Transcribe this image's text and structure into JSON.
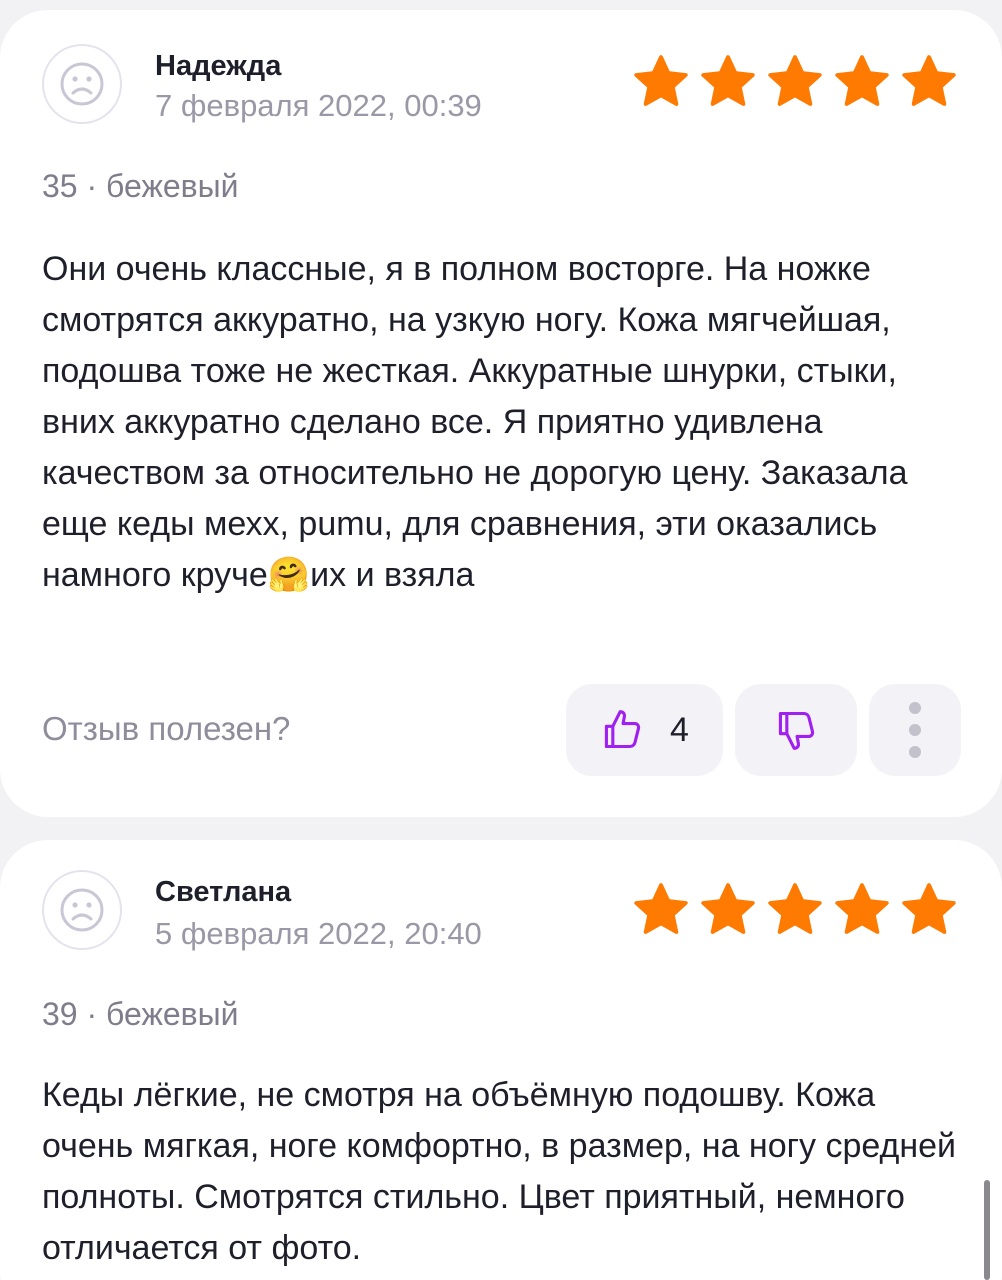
{
  "reviews": [
    {
      "author": "Надежда",
      "date": "7 февраля 2022, 00:39",
      "rating": 5,
      "variant": "35 · бежевый",
      "text_before_emoji": "Они очень классные, я в полном восторге. На ножке смотрятся аккуратно, на узкую ногу. Кожа мягчейшая, подошва тоже не жесткая. Аккуратные шнурки, стыки, вних аккуратно сделано все. Я приятно удивлена качеством за относительно не дорогую цену. Заказала еще кеды мехх, pumu, для сравнения, эти оказались намного круче",
      "emoji": "🤗",
      "text_after_emoji": "их и взяла",
      "helpful_label": "Отзыв полезен?",
      "likes": "4"
    },
    {
      "author": "Светлана",
      "date": "5 февраля 2022, 20:40",
      "rating": 5,
      "variant": "39 · бежевый",
      "text": "Кеды лёгкие, не смотря на объёмную подошву. Кожа очень мягкая, ноге комфортно, в размер, на ногу средней полноты. Смотрятся  стильно. Цвет приятный, немного отличается от фото."
    }
  ],
  "icons": {
    "avatar": "sad-face-icon",
    "star": "star-icon",
    "like": "thumbs-up-icon",
    "dislike": "thumbs-down-icon",
    "more": "more-vertical-icon"
  },
  "colors": {
    "star": "#ff7a00",
    "accent": "#a020f0",
    "text": "#1f1f2b",
    "muted": "#9a98a6",
    "card": "#ffffff",
    "background": "#f2f2f4"
  }
}
